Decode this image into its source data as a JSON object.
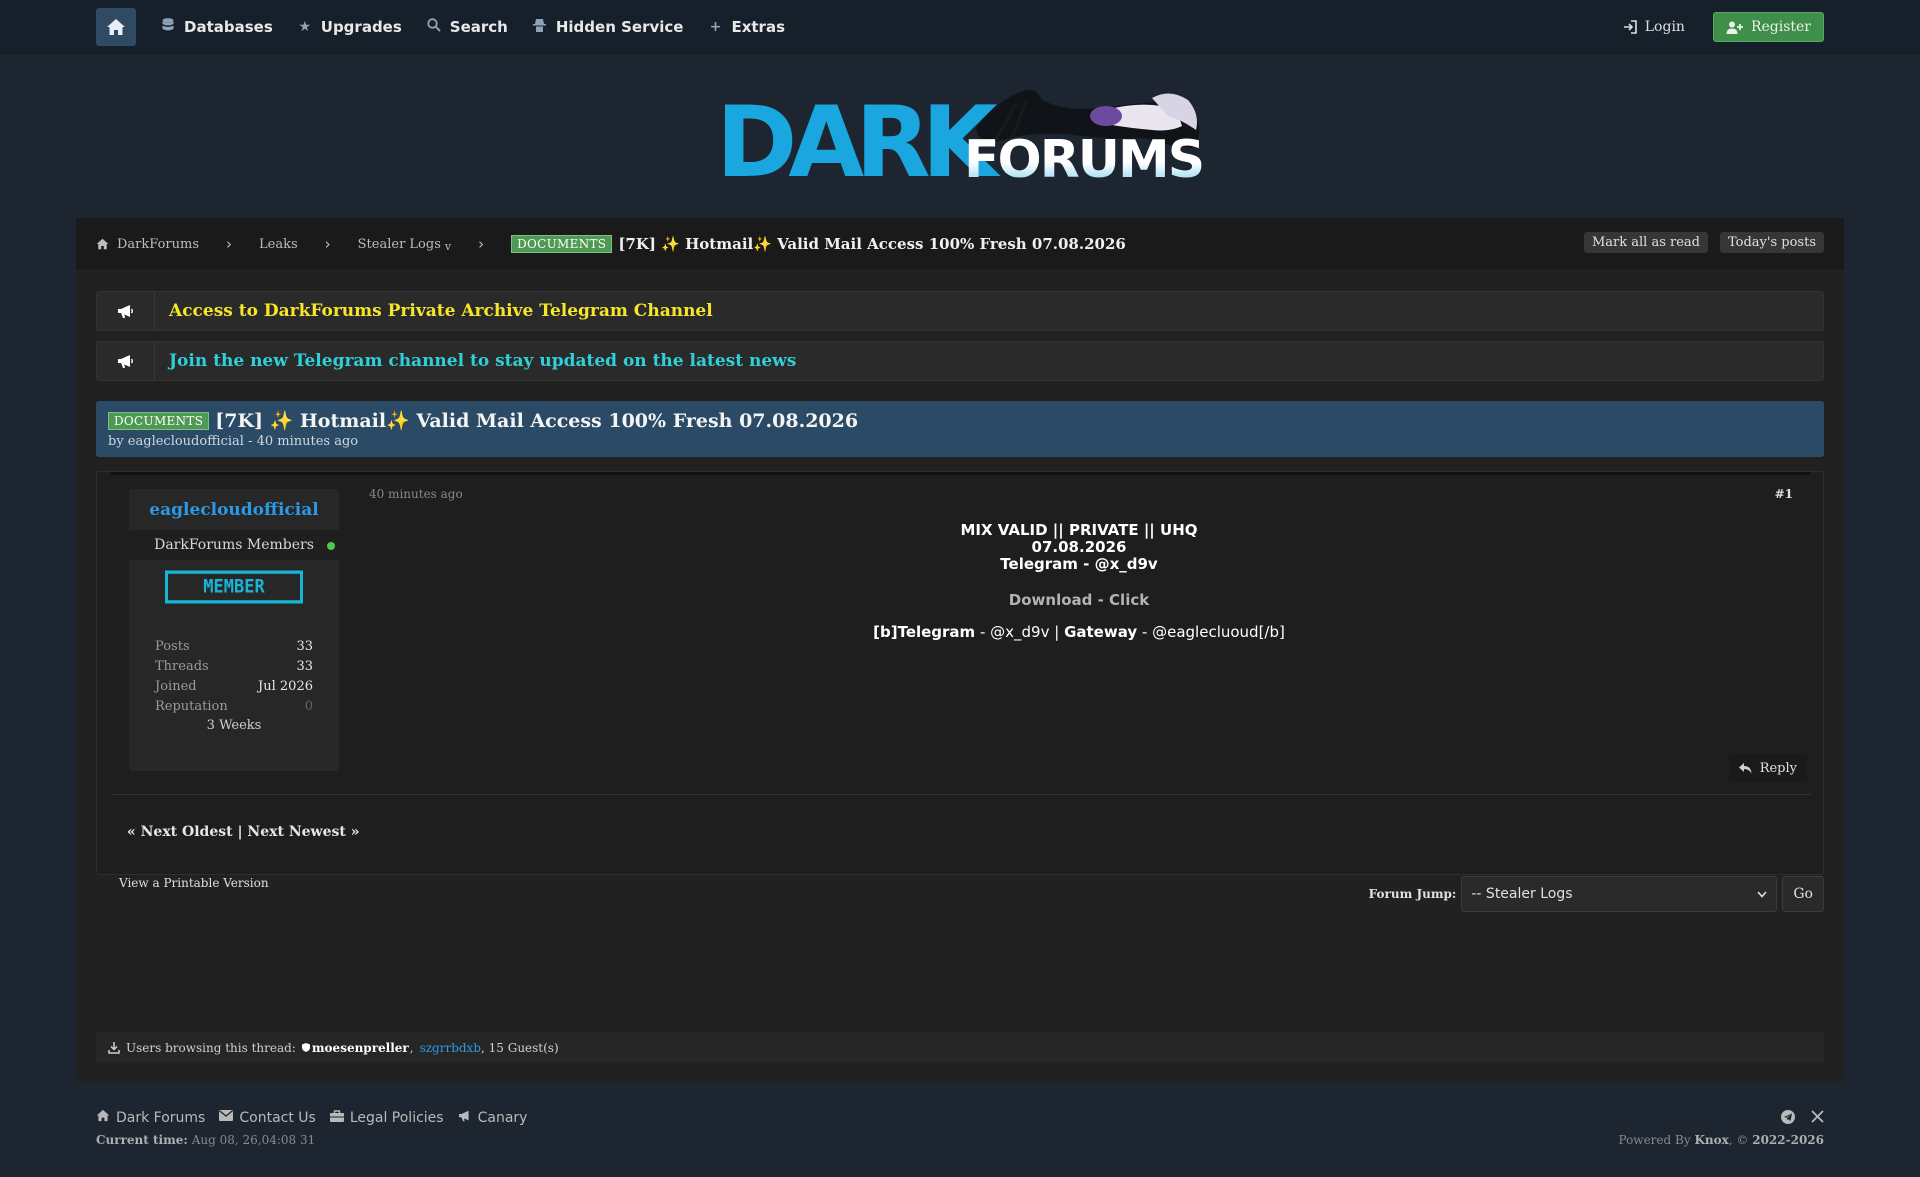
{
  "nav": {
    "items": [
      {
        "label": "Databases",
        "icon": "database-icon"
      },
      {
        "label": "Upgrades",
        "icon": "star-icon"
      },
      {
        "label": "Search",
        "icon": "search-icon"
      },
      {
        "label": "Hidden Service",
        "icon": "incognito-icon"
      },
      {
        "label": "Extras",
        "icon": "plus-icon"
      }
    ],
    "login": "Login",
    "register": "Register"
  },
  "logo": {
    "dark": "DARK",
    "forums": "FORUMS"
  },
  "breadcrumb": {
    "items": [
      "DarkForums",
      "Leaks",
      "Stealer Logs"
    ],
    "dropdown_marker": "v",
    "tag": "DOCUMENTS",
    "title": "[7K] ✨ Hotmail✨ Valid Mail Access 100% Fresh 07.08.2026",
    "mark_read": "Mark all as read",
    "todays_posts": "Today's posts"
  },
  "announcements": [
    {
      "text": "Access to DarkForums Private Archive Telegram Channel",
      "color": "#f5e62a"
    },
    {
      "text": "Join the new Telegram channel to stay updated on the latest news",
      "color": "#2fd1d8"
    }
  ],
  "thread": {
    "tag": "DOCUMENTS",
    "title": "[7K] ✨ Hotmail✨ Valid Mail Access 100% Fresh 07.08.2026",
    "byline": "by eaglecloudofficial - 40 minutes ago"
  },
  "post": {
    "user": {
      "name": "eaglecloudofficial",
      "group": "DarkForums Members",
      "badge": "MEMBER",
      "stats": [
        {
          "k": "Posts",
          "v": "33"
        },
        {
          "k": "Threads",
          "v": "33"
        },
        {
          "k": "Joined",
          "v": "Jul 2026"
        },
        {
          "k": "Reputation",
          "v": "0"
        }
      ],
      "since": "3 Weeks"
    },
    "time": "40 minutes ago",
    "number": "#1",
    "body_lines": [
      "MIX VALID || PRIVATE || UHQ",
      "07.08.2026",
      "Telegram - @x_d9v"
    ],
    "download": "Download - Click",
    "contact": {
      "tele_label": "[b]Telegram",
      "tele_sep": " - ",
      "tele_value": "@x_d9v",
      "pipe": " | ",
      "gw_label": "Gateway",
      "gw_sep": " - ",
      "gw_value": "@eaglecluoud[/b]"
    },
    "reply": "Reply",
    "nav": {
      "oldest": "« Next Oldest",
      "divider": " | ",
      "newest": "Next Newest »"
    }
  },
  "printable": "View a Printable Version",
  "forum_jump": {
    "label": "Forum Jump:",
    "selected": "-- Stealer Logs",
    "go": "Go"
  },
  "browsing": {
    "prefix": "Users browsing this thread:",
    "user1": "moesenpreller",
    "sep": ",",
    "user2": "szgrrbdxb",
    "suffix": ", 15 Guest(s)"
  },
  "footer": {
    "links": [
      {
        "label": "Dark Forums",
        "icon": "home-icon"
      },
      {
        "label": "Contact Us",
        "icon": "envelope-icon"
      },
      {
        "label": "Legal Policies",
        "icon": "briefcase-icon"
      },
      {
        "label": "Canary",
        "icon": "megaphone-icon"
      }
    ],
    "time_label": "Current time:",
    "time_value": "Aug 08, 26,04:08 31",
    "powered_prefix": "Powered By",
    "powered_name": "Knox",
    "powered_mid": ", ©",
    "powered_years": "2022-2026"
  },
  "colors": {
    "accent": "#2b9ae6",
    "member_badge": "#17b5d6",
    "tag": "#4e9a54",
    "register": "#3f8f4a",
    "thread_head": "#2a4a66"
  }
}
